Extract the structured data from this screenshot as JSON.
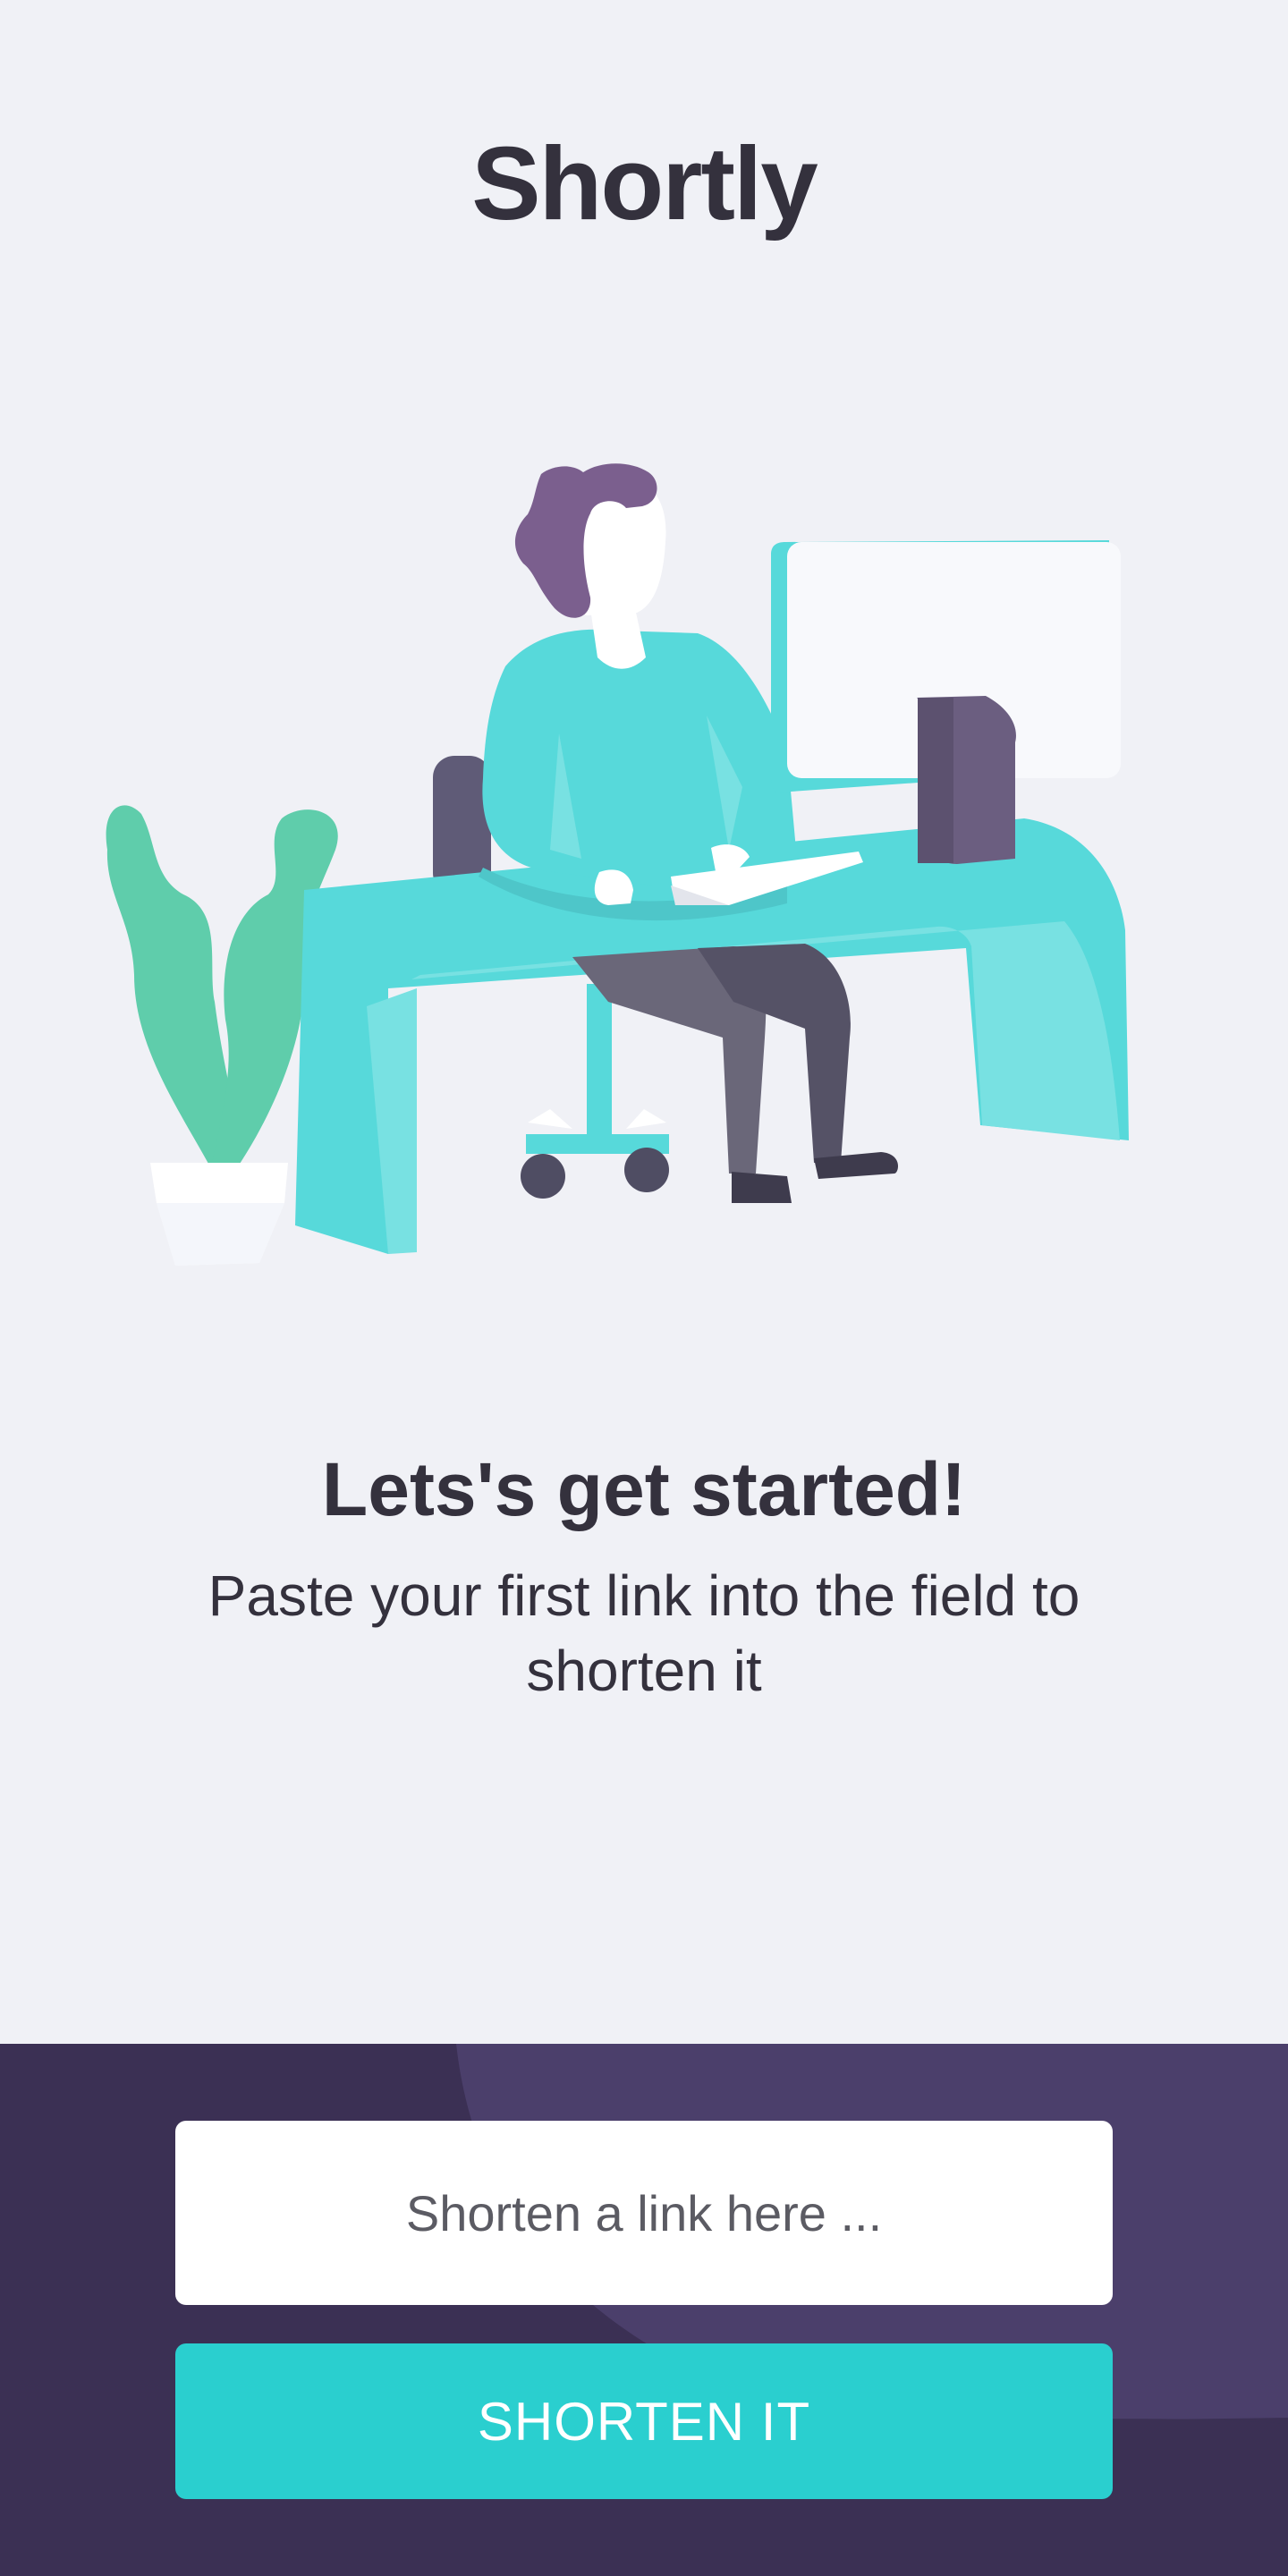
{
  "app": {
    "name": "Shortly"
  },
  "hero": {
    "headline": "Lets's get started!",
    "subtext": "Paste your first link into the field to shorten it"
  },
  "shorten_form": {
    "input_value": "",
    "input_placeholder": "Shorten a link here ...",
    "button_label": "SHORTEN IT"
  },
  "colors": {
    "background": "#f0f1f6",
    "text_dark": "#34313d",
    "footer_dark": "#3b3054",
    "footer_accent": "#4b3f6b",
    "primary_cyan": "#2acfcf",
    "desk_cyan": "#57d9da",
    "plant_green": "#5fcdab",
    "purple": "#6b5e80"
  }
}
